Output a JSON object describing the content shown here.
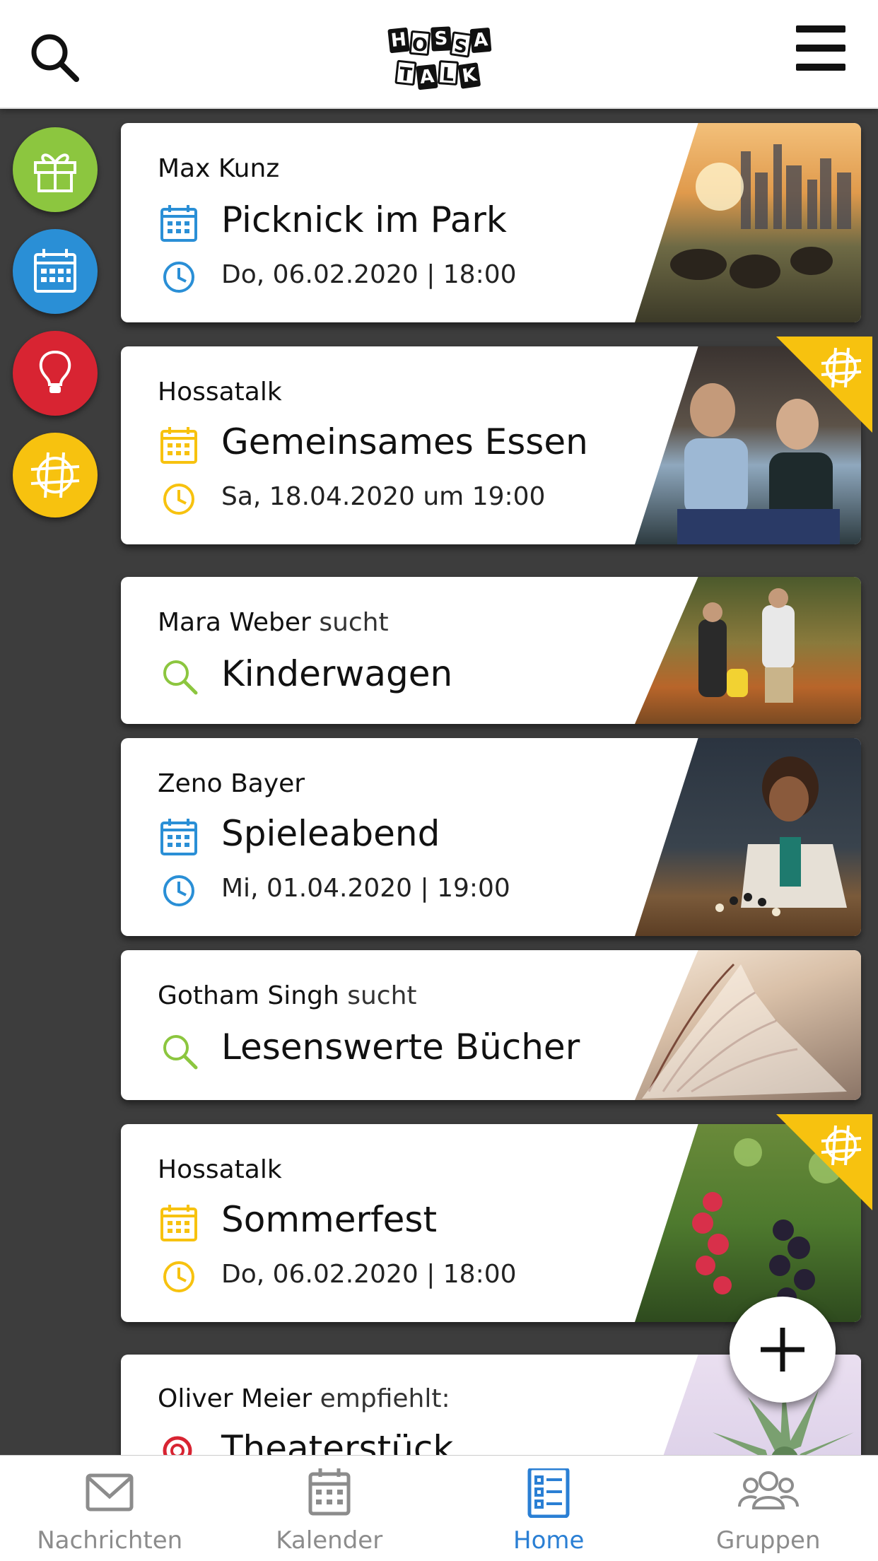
{
  "header": {
    "logo_text": "HOSSA TALK"
  },
  "side_buttons": [
    {
      "icon": "gift-icon",
      "color": "#8cc63f"
    },
    {
      "icon": "calendar-icon",
      "color": "#2a8fd6"
    },
    {
      "icon": "lightbulb-icon",
      "color": "#d82432"
    },
    {
      "icon": "hossatalk-icon",
      "color": "#f7c20f"
    }
  ],
  "cards": [
    {
      "author": "Max Kunz",
      "author_suffix": "",
      "title": "Picknick im Park",
      "date": "Do, 06.02.2020 | 18:00",
      "type": "event",
      "accent": "#2a8fd6"
    },
    {
      "author": "Hossatalk",
      "author_suffix": "",
      "title": "Gemeinsames Essen",
      "date": "Sa, 18.04.2020 um 19:00",
      "type": "event",
      "accent": "#f7c20f"
    },
    {
      "author": "Mara Weber",
      "author_suffix": " sucht",
      "title": "Kinderwagen",
      "date": "",
      "type": "search",
      "accent": "#8cc63f"
    },
    {
      "author": "Zeno Bayer",
      "author_suffix": "",
      "title": "Spieleabend",
      "date": "Mi, 01.04.2020 | 19:00",
      "type": "event",
      "accent": "#2a8fd6"
    },
    {
      "author": "Gotham Singh",
      "author_suffix": " sucht",
      "title": "Lesenswerte Bücher",
      "date": "",
      "type": "search",
      "accent": "#8cc63f"
    },
    {
      "author": "Hossatalk",
      "author_suffix": "",
      "title": "Sommerfest",
      "date": "Do, 06.02.2020 | 18:00",
      "type": "event",
      "accent": "#f7c20f"
    },
    {
      "author": "Oliver Meier",
      "author_suffix": " empfiehlt:",
      "title": "Theaterstück",
      "date": "",
      "type": "recommend",
      "accent": "#d82432"
    }
  ],
  "bottom_nav": [
    {
      "label": "Nachrichten",
      "icon": "envelope-icon",
      "active": false
    },
    {
      "label": "Kalender",
      "icon": "calendar-icon",
      "active": false
    },
    {
      "label": "Home",
      "icon": "list-icon",
      "active": true
    },
    {
      "label": "Gruppen",
      "icon": "group-icon",
      "active": false
    }
  ],
  "colors": {
    "active": "#2a7fd4",
    "inactive": "#8c8c8c",
    "background": "#3d3d3d"
  }
}
